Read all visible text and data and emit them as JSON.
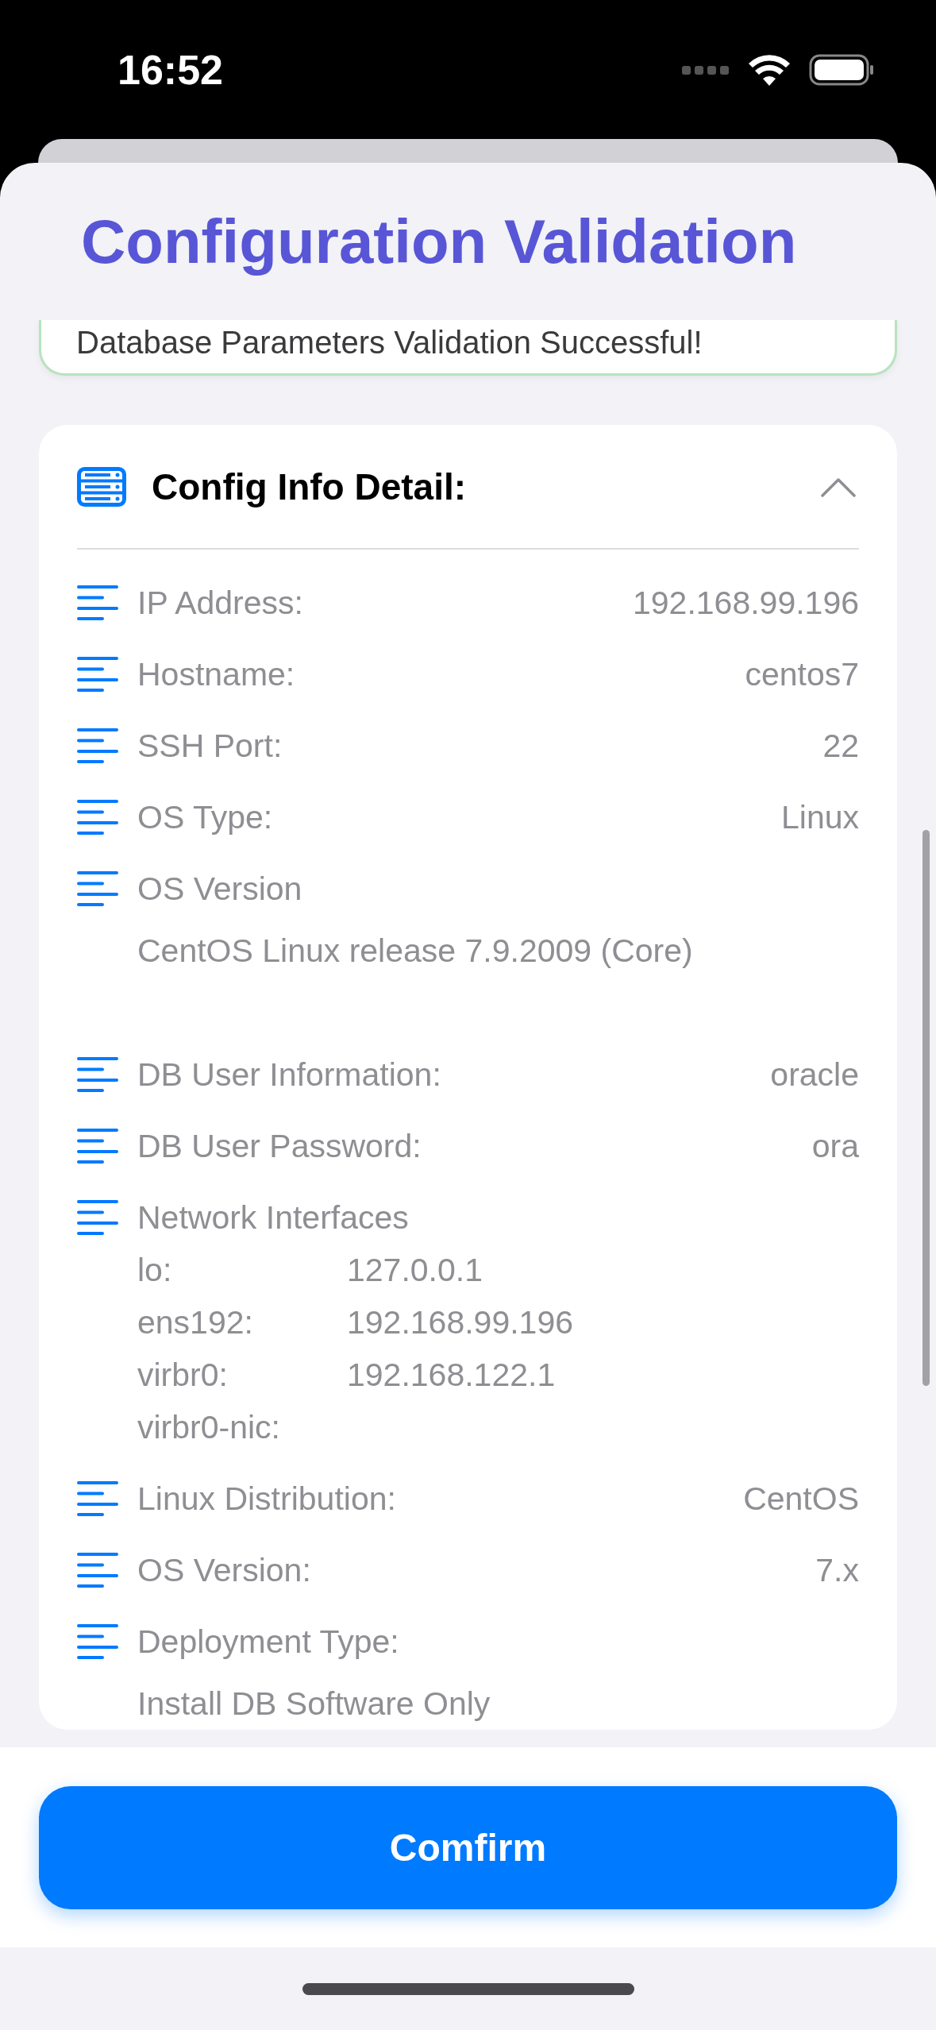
{
  "status_bar": {
    "time": "16:52"
  },
  "title": "Configuration Validation",
  "success_message": "Database Parameters Validation Successful!",
  "detail": {
    "title": "Config Info Detail:",
    "expanded": true,
    "items": [
      {
        "kind": "inline",
        "label": "IP Address:",
        "value": "192.168.99.196"
      },
      {
        "kind": "inline",
        "label": "Hostname:",
        "value": "centos7"
      },
      {
        "kind": "inline",
        "label": "SSH Port:",
        "value": "22"
      },
      {
        "kind": "inline",
        "label": "OS Type:",
        "value": "Linux"
      },
      {
        "kind": "stacked",
        "label": "OS Version",
        "value": "CentOS Linux release 7.9.2009 (Core)"
      },
      {
        "kind": "inline",
        "label": "DB User Information:",
        "value": "oracle"
      },
      {
        "kind": "inline",
        "label": "DB User Password:",
        "value": "ora"
      },
      {
        "kind": "interfaces",
        "label": "Network Interfaces",
        "interfaces": [
          {
            "name": "lo:",
            "address": "127.0.0.1"
          },
          {
            "name": "ens192:",
            "address": "192.168.99.196"
          },
          {
            "name": "virbr0:",
            "address": "192.168.122.1"
          },
          {
            "name": "virbr0-nic:"
          }
        ]
      },
      {
        "kind": "inline",
        "label": "Linux Distribution:",
        "value": "CentOS"
      },
      {
        "kind": "inline",
        "label": "OS Version:",
        "value": "7.x"
      },
      {
        "kind": "stacked",
        "label": "Deployment Type:",
        "value": "Install DB Software Only"
      }
    ]
  },
  "confirm_button": "Comfirm"
}
